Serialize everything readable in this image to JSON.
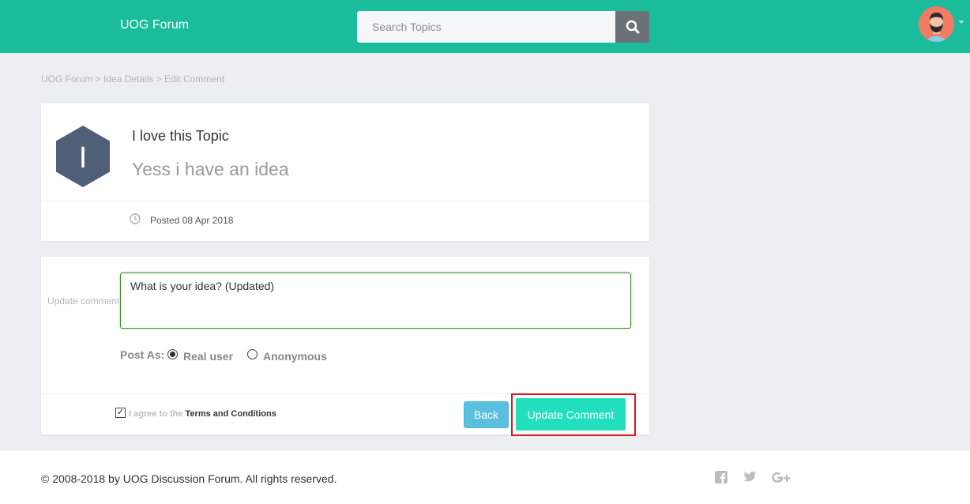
{
  "header": {
    "brand": "UOG Forum",
    "search": {
      "placeholder": "Search Topics",
      "value": ""
    }
  },
  "breadcrumb": "UOG Forum > Idea Details > Edit Comment",
  "topic": {
    "title": "I love this Topic",
    "subtitle": "Yess i have an idea",
    "posted": "Posted 08 Apr 2018",
    "avatar_letter": "I"
  },
  "comment_form": {
    "label": "Update comment",
    "value": "What is your idea? (Updated)",
    "post_as_label": "Post As:",
    "options": [
      "Real user",
      "Anonymous"
    ],
    "selected": "Real user",
    "agree_text": "I agree to the",
    "terms_text": "Terms and Conditions",
    "agree_checked": true,
    "back_label": "Back",
    "update_label": "Update Comment"
  },
  "footer": {
    "copyright": "© 2008-2018 by UOG Discussion Forum. All rights reserved.",
    "social": [
      "facebook-icon",
      "twitter-icon",
      "google-plus-icon"
    ]
  },
  "colors": {
    "primary": "#1BBC9B",
    "update_button": "#22E0BD",
    "back_button": "#5BC0DE",
    "highlight": "#E0161D",
    "hexagon": "#4E5F77"
  }
}
